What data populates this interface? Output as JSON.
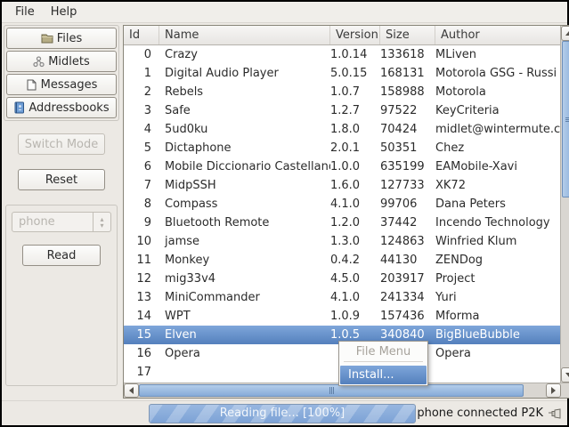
{
  "menubar": {
    "items": [
      "File",
      "Help"
    ]
  },
  "sidebar": {
    "nav_buttons": [
      {
        "label": "Files",
        "icon": "folder-icon"
      },
      {
        "label": "Midlets",
        "icon": "midlet-icon"
      },
      {
        "label": "Messages",
        "icon": "message-icon"
      },
      {
        "label": "Addressbooks",
        "icon": "addressbook-icon"
      }
    ],
    "switch_mode_label": "Switch Mode",
    "reset_label": "Reset",
    "phone_combo_value": "phone",
    "read_label": "Read"
  },
  "table": {
    "columns": [
      "Id",
      "Name",
      "Version",
      "Size",
      "Author"
    ],
    "selected_row_id": "15",
    "rows": [
      {
        "id": "0",
        "name": "Crazy",
        "version": "1.0.14",
        "size": "133618",
        "author": "MLiven"
      },
      {
        "id": "1",
        "name": "Digital Audio Player",
        "version": "5.0.15",
        "size": "168131",
        "author": "Motorola GSG - Russi"
      },
      {
        "id": "2",
        "name": "Rebels",
        "version": "1.0.7",
        "size": "158988",
        "author": "Motorola"
      },
      {
        "id": "3",
        "name": "Safe",
        "version": "1.2.7",
        "size": "97522",
        "author": "KeyCriteria"
      },
      {
        "id": "4",
        "name": "5ud0ku",
        "version": "1.8.0",
        "size": "70424",
        "author": "midlet@wintermute.c"
      },
      {
        "id": "5",
        "name": "Dictaphone",
        "version": "2.0.1",
        "size": "50351",
        "author": "Chez"
      },
      {
        "id": "6",
        "name": "Mobile Diccionario Castellano",
        "version": "1.0.0",
        "size": "635199",
        "author": "EAMobile-Xavi"
      },
      {
        "id": "7",
        "name": "MidpSSH",
        "version": "1.6.0",
        "size": "127733",
        "author": "XK72"
      },
      {
        "id": "8",
        "name": "Compass",
        "version": "4.1.0",
        "size": "99706",
        "author": "Dana Peters"
      },
      {
        "id": "9",
        "name": "Bluetooth Remote",
        "version": "1.2.0",
        "size": "37442",
        "author": "Incendo Technology"
      },
      {
        "id": "10",
        "name": "jamse",
        "version": "1.3.0",
        "size": "124863",
        "author": "Winfried Klum"
      },
      {
        "id": "11",
        "name": "Monkey",
        "version": "0.4.2",
        "size": "44130",
        "author": "ZENDog"
      },
      {
        "id": "12",
        "name": "mig33v4",
        "version": "4.5.0",
        "size": "203917",
        "author": "Project"
      },
      {
        "id": "13",
        "name": "MiniCommander",
        "version": "4.1.0",
        "size": "241334",
        "author": "Yuri"
      },
      {
        "id": "14",
        "name": "WPT",
        "version": "1.0.9",
        "size": "157436",
        "author": "Mforma"
      },
      {
        "id": "15",
        "name": "Elven",
        "version": "1.0.5",
        "size": "340840",
        "author": "BigBlueBubble"
      },
      {
        "id": "16",
        "name": "Opera",
        "version": "",
        "size": "",
        "author": "Opera"
      },
      {
        "id": "17",
        "name": "",
        "version": "",
        "size": "",
        "author": ""
      }
    ]
  },
  "context_menu": {
    "title": "File Menu",
    "items": [
      "Install..."
    ]
  },
  "statusbar": {
    "progress_text": "Reading file... [100%]",
    "status_text": "phone connected P2K"
  },
  "colors": {
    "selection_blue": "#5e8bc7",
    "window_bg": "#ece9e4",
    "progress_blue": "#7da3d6"
  }
}
